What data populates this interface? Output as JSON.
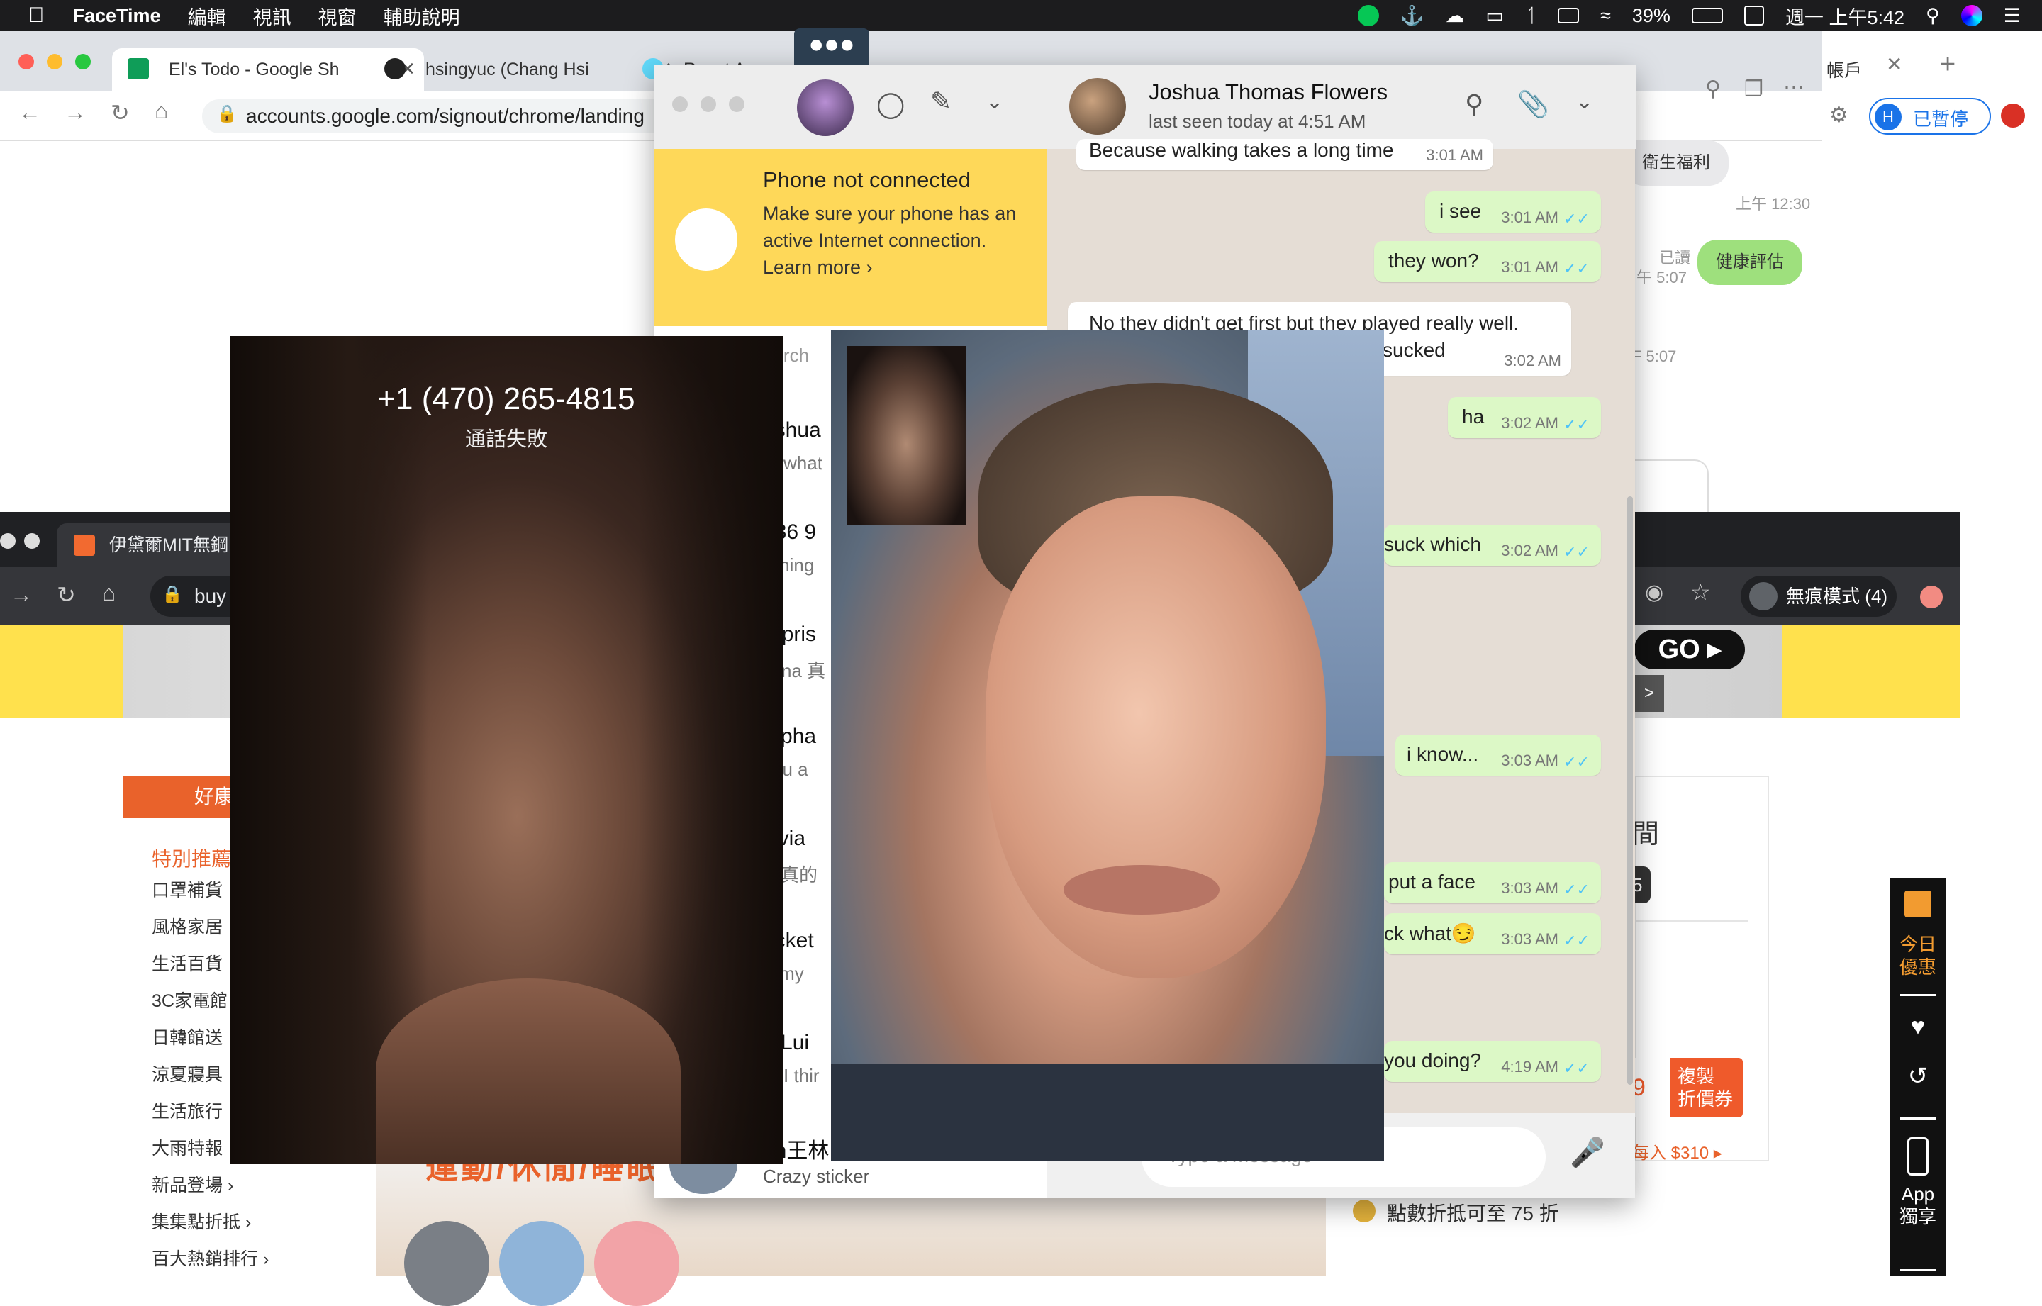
{
  "menubar": {
    "app": "FaceTime",
    "items": [
      "編輯",
      "視訊",
      "視窗",
      "輔助說明"
    ],
    "battery": "39%",
    "datetime": "週一 上午5:42"
  },
  "chrome_back": {
    "tabs": [
      "El's Todo - Google Sh",
      "hsingyuc (Chang Hsi",
      "React App"
    ],
    "right_tab": "帳戶",
    "url": "accounts.google.com/signout/chrome/landing",
    "paused_label": "已暫停",
    "profile_initial": "H",
    "line_chat": {
      "msg1": "衛生福利",
      "time1": "上午 12:30",
      "read_label": "已讀",
      "time2": "午 5:07",
      "msg2": "健康評估",
      "time3": "F 5:07"
    }
  },
  "chrome_front": {
    "tab": "伊黛爾MIT無鋼圈",
    "url": "buy",
    "incognito": "無痕模式 (4)",
    "go": "GO",
    "arrow": ">",
    "side_header": "好康",
    "side_feature": "特別推薦",
    "side_items": [
      "口罩補貨",
      "風格家居",
      "生活百貨",
      "3C家電館",
      "日韓館送",
      "涼夏寢具",
      "生活旅行",
      "大雨特報",
      "新品登場 ›",
      "集集點折抵 ›",
      "百大熱銷排行 ›"
    ],
    "promo_text": "運動/休閒/睡眠",
    "right_title": "間",
    "right_num": "5",
    "coupon_digit": "9",
    "coupon": "複製\n折價券",
    "each": "每入 $310",
    "points": "點數折抵可至 75 折",
    "sidebar": {
      "deal": "今日\n優惠",
      "app": "App\n獨享"
    }
  },
  "whatsapp": {
    "banner_title": "Phone not connected",
    "banner_body": "Make sure your phone has an active Internet connection.",
    "banner_link": "Learn more ›",
    "search_placeholder": "earch",
    "chats": [
      {
        "name": "oshua",
        "msg": "✓ what"
      },
      {
        "name": "886 9",
        "msg": "orning"
      },
      {
        "name": "urpris",
        "msg": "elina 真"
      },
      {
        "name": "tepha",
        "msg": "you a"
      },
      {
        "name": "ylvia",
        "msg": "✓ 真的"
      },
      {
        "name": "ucket",
        "msg": "remy"
      },
      {
        "name": "n Lui",
        "msg": "✓ I thir"
      },
      {
        "name": "un王林",
        "msg": "Crazy sticker"
      }
    ],
    "contact_name": "Joshua Thomas Flowers",
    "last_seen": "last seen today at 4:51 AM",
    "messages": [
      {
        "text": "Because walking takes a long time",
        "time": "3:01 AM",
        "dir": "in"
      },
      {
        "text": "i see",
        "time": "3:01 AM",
        "dir": "out"
      },
      {
        "text": "they won?",
        "time": "3:01 AM",
        "dir": "out"
      },
      {
        "text": "No they didn't get first but they played really well.",
        "text2": "sucked",
        "time": "3:02 AM",
        "dir": "in"
      },
      {
        "text": "ha",
        "time": "3:02 AM",
        "dir": "out"
      },
      {
        "text": "suck which",
        "time": "3:02 AM",
        "dir": "out"
      },
      {
        "text": "i know...",
        "time": "3:03 AM",
        "dir": "out"
      },
      {
        "text": "put a face",
        "time": "3:03 AM",
        "dir": "out"
      },
      {
        "text": "ck what😏",
        "time": "3:03 AM",
        "dir": "out"
      },
      {
        "text": "you doing?",
        "time": "4:19 AM",
        "dir": "out"
      }
    ],
    "input_placeholder": "Type a message"
  },
  "facetime": {
    "number": "+1 (470) 265-4815",
    "status": "通話失敗"
  },
  "colors": {
    "whatsapp_banner": "#fed859",
    "outgoing_bubble": "#dcf8c6",
    "shop_orange": "#e9622b",
    "shop_yellow": "#ffe14d"
  }
}
